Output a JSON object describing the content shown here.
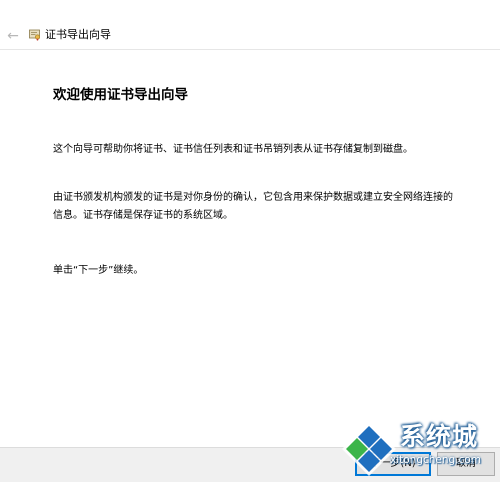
{
  "titlebar": {
    "title": "证书导出向导",
    "back_icon": "back-arrow-icon",
    "app_icon": "certificate-icon"
  },
  "content": {
    "heading": "欢迎使用证书导出向导",
    "paragraphs": [
      "这个向导可帮助你将证书、证书信任列表和证书吊销列表从证书存储复制到磁盘。",
      "由证书颁发机构颁发的证书是对你身份的确认，它包含用来保护数据或建立安全网络连接的信息。证书存储是保存证书的系统区域。",
      "单击“下一步”继续。"
    ]
  },
  "footer": {
    "next_label": "下一步(N)",
    "cancel_label": "取消"
  },
  "watermark": {
    "brand": "系统城",
    "url": "xitongcheng.com",
    "colors": {
      "blue": "#1f6fbf",
      "green": "#3cb54a"
    }
  },
  "colors": {
    "accent": "#0078d7",
    "footer_bg": "#f0f0f0",
    "button_bg": "#e1e1e1"
  }
}
